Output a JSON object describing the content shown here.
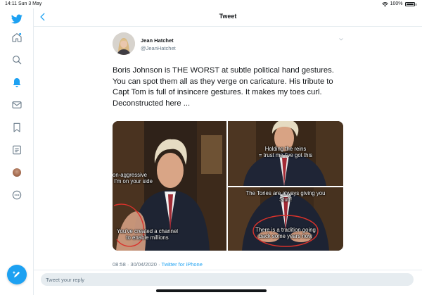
{
  "status_bar": {
    "time_date": "14:11  Sun 3 May",
    "battery": "100%"
  },
  "header": {
    "title": "Tweet"
  },
  "nav": [
    {
      "name": "twitter-logo-icon"
    },
    {
      "name": "home-icon"
    },
    {
      "name": "explore-icon"
    },
    {
      "name": "notifications-icon"
    },
    {
      "name": "messages-icon"
    },
    {
      "name": "bookmarks-icon"
    },
    {
      "name": "lists-icon"
    },
    {
      "name": "profile-icon"
    },
    {
      "name": "more-icon"
    }
  ],
  "tweet": {
    "author_name": "Jean Hatchet",
    "author_handle": "@JeanHatchet",
    "text": "Boris Johnson is THE WORST at subtle political hand gestures. You can spot them all as they verge on caricature. His tribute to Capt Tom is full of insincere gestures. It makes my toes curl. Deconstructed here ...",
    "timestamp": "08:58 · 30/04/2020 ·",
    "source": "Twitter for iPhone",
    "media_captions": {
      "left_top": "on-aggressive\n I'm on your side",
      "left_bottom": "You've created a channel\nto enable millions",
      "right_top": "Holding the reins\n= trust me I've got this",
      "right_middle": "The Tories are always giving you\nStuff!",
      "right_bottom": "There is a tradition going\nback some years now"
    }
  },
  "reply": {
    "placeholder": "Tweet your reply"
  },
  "colors": {
    "accent": "#1da1f2",
    "text": "#14171a",
    "secondary": "#657786",
    "border": "#e6ecf0"
  }
}
